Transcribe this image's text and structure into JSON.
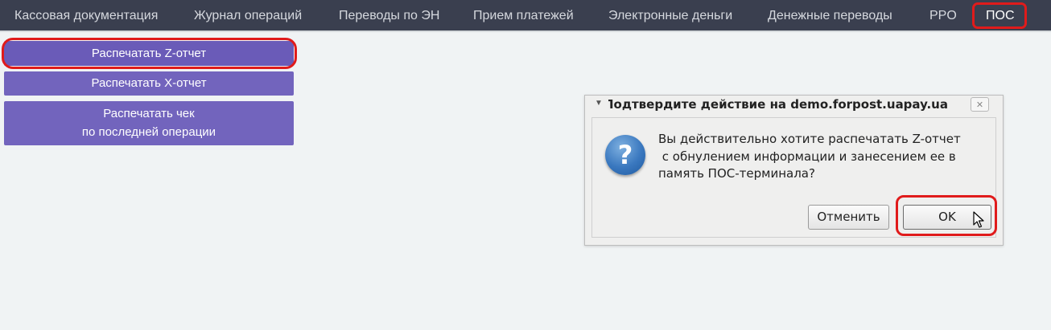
{
  "nav": {
    "items": [
      {
        "label": "Кассовая документация"
      },
      {
        "label": "Журнал операций"
      },
      {
        "label": "Переводы по ЭН"
      },
      {
        "label": "Прием платежей"
      },
      {
        "label": "Электронные деньги"
      },
      {
        "label": "Денежные переводы"
      },
      {
        "label": "PPO"
      },
      {
        "label": "ПОС"
      }
    ],
    "active": "ПОС"
  },
  "actions": {
    "print_z": "Распечатать Z-отчет",
    "print_x": "Распечатать X-отчет",
    "print_last_line1": "Распечатать чек",
    "print_last_line2": "по последней операции"
  },
  "dialog": {
    "title": "Подтвердите действие на demo.forpost.uapay.ua",
    "message": "Вы действительно хотите распечатать Z-отчет\n с обнулением информации и занесением ее в\nпамять ПОС-терминала?",
    "cancel_label": "Отменить",
    "ok_label": "OK",
    "close_glyph": "✕",
    "icon": "question-icon"
  },
  "colors": {
    "nav_bg": "#3a3f4f",
    "button_bg": "#7264bd",
    "highlight": "#e01b1b"
  }
}
